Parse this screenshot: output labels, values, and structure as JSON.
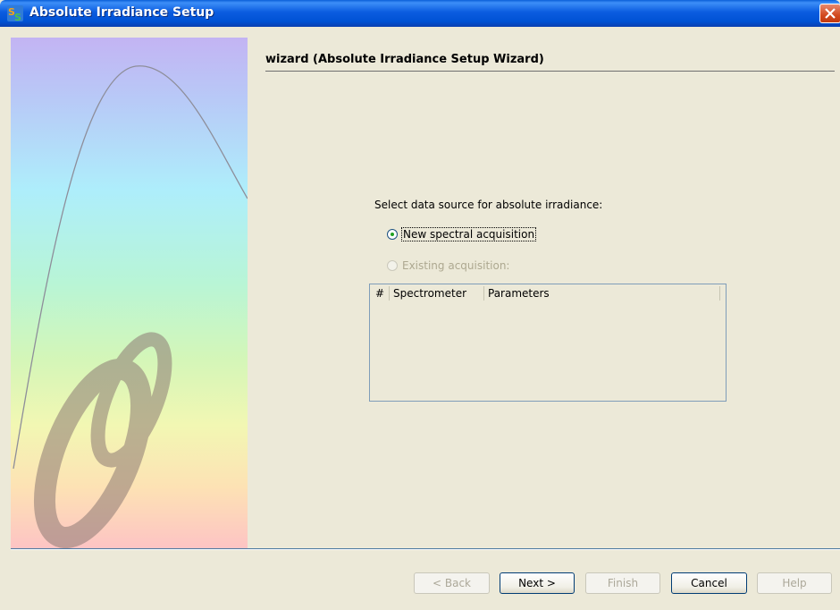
{
  "window": {
    "title": "Absolute Irradiance Setup",
    "app_icon": "spectrasuite-icon",
    "close_icon": "close-icon"
  },
  "wizard": {
    "heading": "wizard (Absolute Irradiance Setup Wizard)",
    "prompt": "Select data source for absolute irradiance:",
    "options": [
      {
        "label": "New spectral acquisition",
        "selected": true,
        "enabled": true
      },
      {
        "label": "Existing acquisition:",
        "selected": false,
        "enabled": false
      }
    ],
    "table": {
      "columns": [
        "#",
        "Spectrometer",
        "Parameters"
      ],
      "rows": []
    }
  },
  "buttons": {
    "back": "< Back",
    "next": "Next >",
    "finish": "Finish",
    "cancel": "Cancel",
    "help": "Help"
  }
}
